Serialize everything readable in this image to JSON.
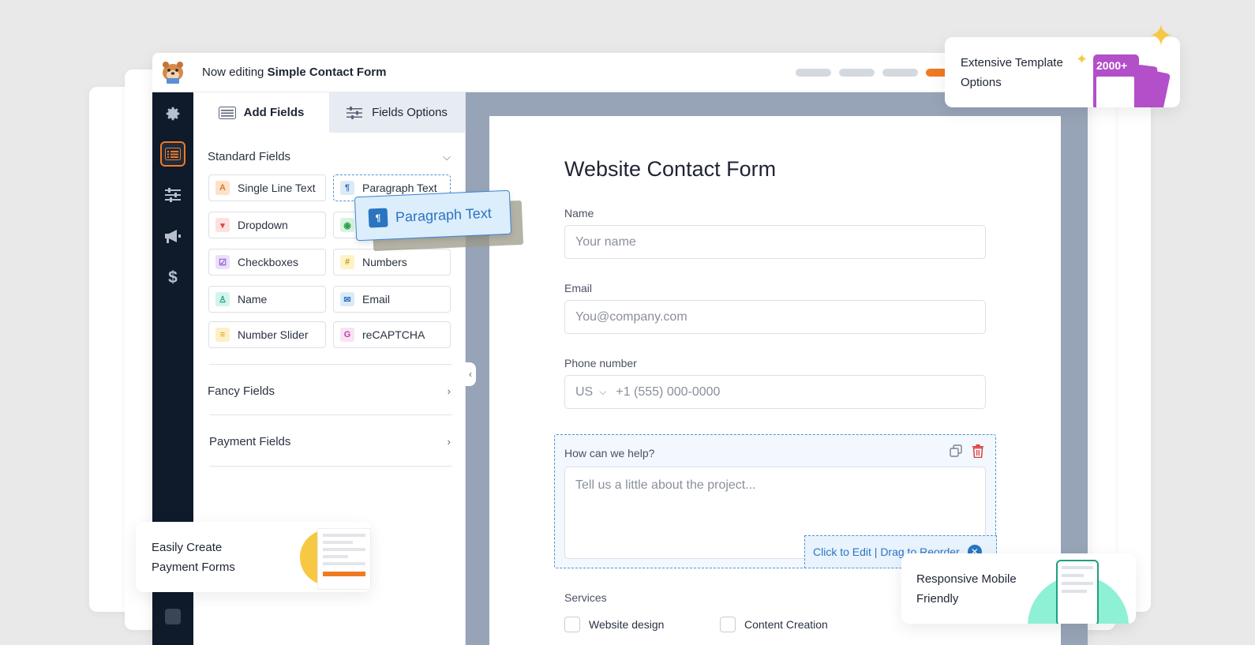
{
  "topbar": {
    "prefix": "Now editing",
    "form_name": "Simple Contact Form"
  },
  "sidebar": {
    "items": [
      {
        "icon": "gear-icon"
      },
      {
        "icon": "form-list-icon",
        "active": true
      },
      {
        "icon": "sliders-icon"
      },
      {
        "icon": "megaphone-icon"
      },
      {
        "icon": "dollar-icon",
        "glyph": "$"
      },
      {
        "icon": "square-icon"
      }
    ]
  },
  "panel": {
    "tabs": [
      {
        "label": "Add Fields",
        "active": true
      },
      {
        "label": "Fields Options",
        "active": false
      }
    ],
    "standard_fields": {
      "title": "Standard Fields",
      "items": [
        {
          "label": "Single Line Text",
          "icon": "text-icon",
          "glyph": "A",
          "color": "#fde2c8",
          "fg": "#e2772b"
        },
        {
          "label": "Paragraph Text",
          "icon": "paragraph-icon",
          "glyph": "¶",
          "color": "#dceaf8",
          "fg": "#2b74c0"
        },
        {
          "label": "Dropdown",
          "icon": "dropdown-icon",
          "glyph": "▾",
          "color": "#fde0e0",
          "fg": "#d94848"
        },
        {
          "label": "",
          "icon": "radio-icon",
          "glyph": "◉",
          "color": "#d9f3df",
          "fg": "#2f9e4f"
        },
        {
          "label": "Checkboxes",
          "icon": "checkbox-icon",
          "glyph": "☑",
          "color": "#ebe0f9",
          "fg": "#8a56d6"
        },
        {
          "label": "Numbers",
          "icon": "hash-icon",
          "glyph": "#",
          "color": "#fdf3c7",
          "fg": "#c99a0a"
        },
        {
          "label": "Name",
          "icon": "user-icon",
          "glyph": "♙",
          "color": "#d3f4ec",
          "fg": "#1f9f80"
        },
        {
          "label": "Email",
          "icon": "mail-icon",
          "glyph": "✉",
          "color": "#dceaf8",
          "fg": "#2b74c0"
        },
        {
          "label": "Number Slider",
          "icon": "slider-icon",
          "glyph": "≡",
          "color": "#fdf0c7",
          "fg": "#d89b10"
        },
        {
          "label": "reCAPTCHA",
          "icon": "google-icon",
          "glyph": "G",
          "color": "#f8e3f3",
          "fg": "#c441a8"
        }
      ]
    },
    "fancy_fields": {
      "title": "Fancy Fields"
    },
    "payment_fields": {
      "title": "Payment Fields"
    }
  },
  "drag_chip": {
    "label": "Paragraph Text"
  },
  "form": {
    "title": "Website Contact Form",
    "name": {
      "label": "Name",
      "placeholder": "Your name"
    },
    "email": {
      "label": "Email",
      "placeholder": "You@company.com"
    },
    "phone": {
      "label": "Phone number",
      "country": "US",
      "placeholder": "+1 (555) 000-0000"
    },
    "help": {
      "label": "How can we help?",
      "placeholder": "Tell us a little about the project...",
      "edit_hint": "Click to Edit | Drag to Reorder"
    },
    "services": {
      "label": "Services",
      "options": [
        "Website design",
        "Content Creation"
      ]
    }
  },
  "promos": {
    "templates": {
      "line1": "Extensive Template",
      "line2": "Options",
      "badge": "2000+"
    },
    "payment": {
      "line1": "Easily Create",
      "line2": "Payment Forms"
    },
    "mobile": {
      "line1": "Responsive Mobile",
      "line2": "Friendly"
    }
  },
  "colors": {
    "accent": "#f07a22",
    "primary_blue": "#2b74c0",
    "sidebar_bg": "#0f1a2b",
    "canvas_bg": "#97a3b7",
    "template_purple": "#b24fc9",
    "payment_yellow": "#f7c844",
    "mobile_mint": "#8ef0d5"
  }
}
